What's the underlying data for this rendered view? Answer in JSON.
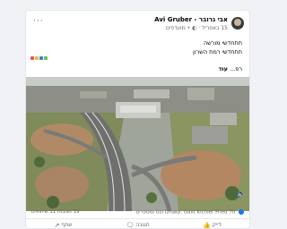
{
  "post": {
    "author": "אבי גרובר - Avi Gruber",
    "meta": "15 באפריל · ◐ • מועדפים",
    "line1": "תתחדשי מורשה",
    "line2": "תתחדשי רמת השרון",
    "see_more_prefix": "רפ...",
    "see_more_label": "עוד",
    "menu_glyph": "···"
  },
  "stats": {
    "reactions": "70 Uzi Izhaky, Galit Kichler Fried ומספרים",
    "counts": "19 תגובות 11 שיתופים"
  },
  "actions": {
    "like": "לייק",
    "comment": "תגובה",
    "share": "שתף"
  },
  "colors": {
    "accent": "#1877f2",
    "text_secondary": "#65676b"
  }
}
